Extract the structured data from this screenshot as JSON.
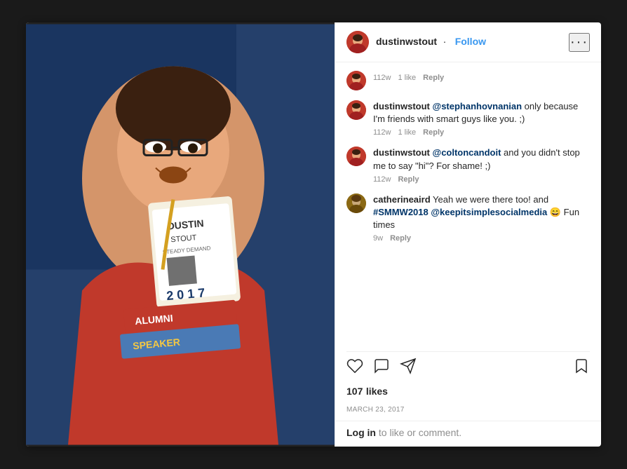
{
  "header": {
    "username": "dustinwstout",
    "dot": "·",
    "follow_label": "Follow",
    "more_icon": "···"
  },
  "comments": [
    {
      "id": "c1",
      "avatar_label": "D",
      "avatar_color": "#c0392b",
      "username": "",
      "text": "",
      "time": "112w",
      "likes": "1 like",
      "reply_label": "Reply"
    },
    {
      "id": "c2",
      "avatar_label": "D",
      "avatar_color": "#c0392b",
      "username": "dustinwstout",
      "mention": "@stephanhovnanian",
      "text": " only because I'm friends with smart guys like you. ;)",
      "time": "112w",
      "likes": "1 like",
      "reply_label": "Reply"
    },
    {
      "id": "c3",
      "avatar_label": "D",
      "avatar_color": "#c0392b",
      "username": "dustinwstout",
      "mention": "@coltoncandoit",
      "text": " and you didn't stop me to say \"hi\"? For shame! ;)",
      "time": "112w",
      "likes": "",
      "reply_label": "Reply"
    },
    {
      "id": "c4",
      "avatar_label": "C",
      "avatar_color": "#8B6914",
      "username": "catherineaird",
      "mention": "",
      "text": " Yeah we were there too! and ",
      "hashtag1": "#SMMW2018",
      "mention2": "@keepitsimplesocialmedia",
      "emoji": "😄",
      "text2": " Fun times",
      "time": "9w",
      "likes": "",
      "reply_label": "Reply"
    }
  ],
  "actions": {
    "like_icon": "♡",
    "comment_icon": "💬",
    "share_icon": "↑",
    "bookmark_icon": "🔖"
  },
  "likes": {
    "count": "107",
    "label": "likes"
  },
  "date": "MARCH 23, 2017",
  "footer": {
    "pre_login": "",
    "login_label": "Log in",
    "post_login": " to like or comment."
  }
}
